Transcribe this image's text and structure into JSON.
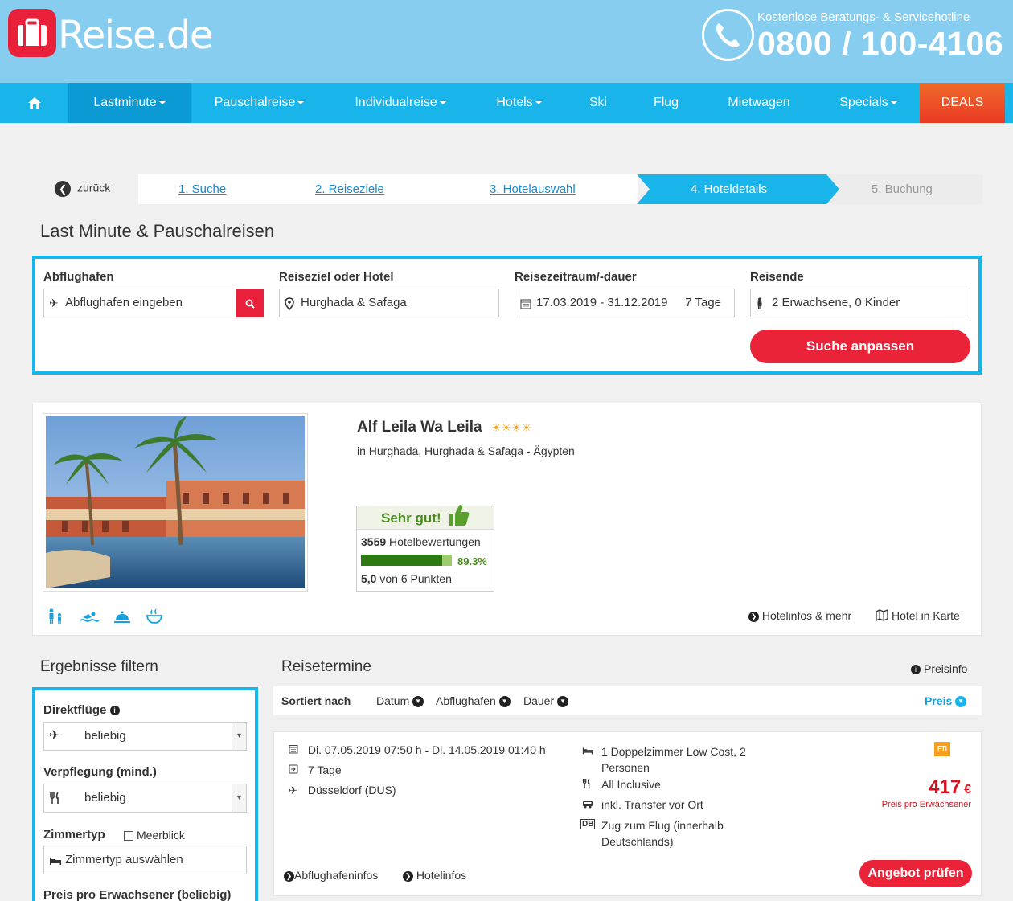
{
  "header": {
    "logo_main": "Reise",
    "logo_tld": ".de",
    "hotline_label": "Kostenlose Beratungs- & Servicehotline",
    "hotline_number": "0800 / 100-4106"
  },
  "nav": {
    "items": [
      {
        "label": "Lastminute",
        "dropdown": true
      },
      {
        "label": "Pauschalreise",
        "dropdown": true
      },
      {
        "label": "Individualreise",
        "dropdown": true
      },
      {
        "label": "Hotels",
        "dropdown": true
      },
      {
        "label": "Ski",
        "dropdown": false
      },
      {
        "label": "Flug",
        "dropdown": false
      },
      {
        "label": "Mietwagen",
        "dropdown": false
      },
      {
        "label": "Specials",
        "dropdown": true
      }
    ],
    "deals_label": "DEALS"
  },
  "steps": {
    "back_label": "zurück",
    "items": [
      "1. Suche",
      "2. Reiseziele",
      "3. Hotelauswahl",
      "4. Hoteldetails",
      "5. Buchung"
    ]
  },
  "page_title": "Last Minute & Pauschalreisen",
  "search": {
    "departure_label": "Abflughafen",
    "departure_placeholder": "Abflughafen eingeben",
    "destination_label": "Reiseziel oder Hotel",
    "destination_value": "Hurghada & Safaga",
    "period_label": "Reisezeitraum/-dauer",
    "period_value": "17.03.2019 - 31.12.2019",
    "duration_value": "7 Tage",
    "travellers_label": "Reisende",
    "travellers_value": "2 Erwachsene, 0 Kinder",
    "submit_label": "Suche anpassen"
  },
  "hotel": {
    "name": "Alf Leila Wa Leila",
    "stars": "☀☀☀☀",
    "location": "in Hurghada, Hurghada & Safaga - Ägypten",
    "rating_label": "Sehr gut!",
    "review_count": "3559",
    "review_label": "Hotelbewertungen",
    "recommend_percent": "89.3%",
    "recommend_fraction": 0.893,
    "score": "5,0",
    "score_label": "von 6 Punkten",
    "info_link": "Hotelinfos & mehr",
    "map_link": "Hotel in Karte",
    "amenity_icons": [
      "family-icon",
      "swimming-icon",
      "service-bell-icon",
      "spa-icon"
    ]
  },
  "filter": {
    "title": "Ergebnisse filtern",
    "direct_label": "Direktflüge",
    "direct_value": "beliebig",
    "board_label": "Verpflegung (mind.)",
    "board_value": "beliebig",
    "room_label": "Zimmertyp",
    "seaview_label": "Meerblick",
    "room_placeholder": "Zimmertyp auswählen",
    "price_label": "Preis pro Erwachsener (beliebig)"
  },
  "results": {
    "title": "Reisetermine",
    "price_info": "Preisinfo",
    "sort_label": "Sortiert nach",
    "sort_options": [
      "Datum",
      "Abflughafen",
      "Dauer"
    ],
    "sort_active": "Preis",
    "offer": {
      "dates": "Di. 07.05.2019 07:50 h - Di. 14.05.2019 01:40 h",
      "duration": "7 Tage",
      "airport": "Düsseldorf (DUS)",
      "room": "1 Doppelzimmer Low Cost, 2 Personen",
      "board": "All Inclusive",
      "transfer": "inkl. Transfer vor Ort",
      "train_badge": "DB",
      "train": "Zug zum Flug (innerhalb Deutschlands)",
      "operator_badge": "FTI",
      "price": "417",
      "currency": "€",
      "price_note": "Preis pro Erwachsener",
      "airport_info": "Abflughafeninfos",
      "hotel_info": "Hotelinfos",
      "cta": "Angebot prüfen"
    }
  }
}
